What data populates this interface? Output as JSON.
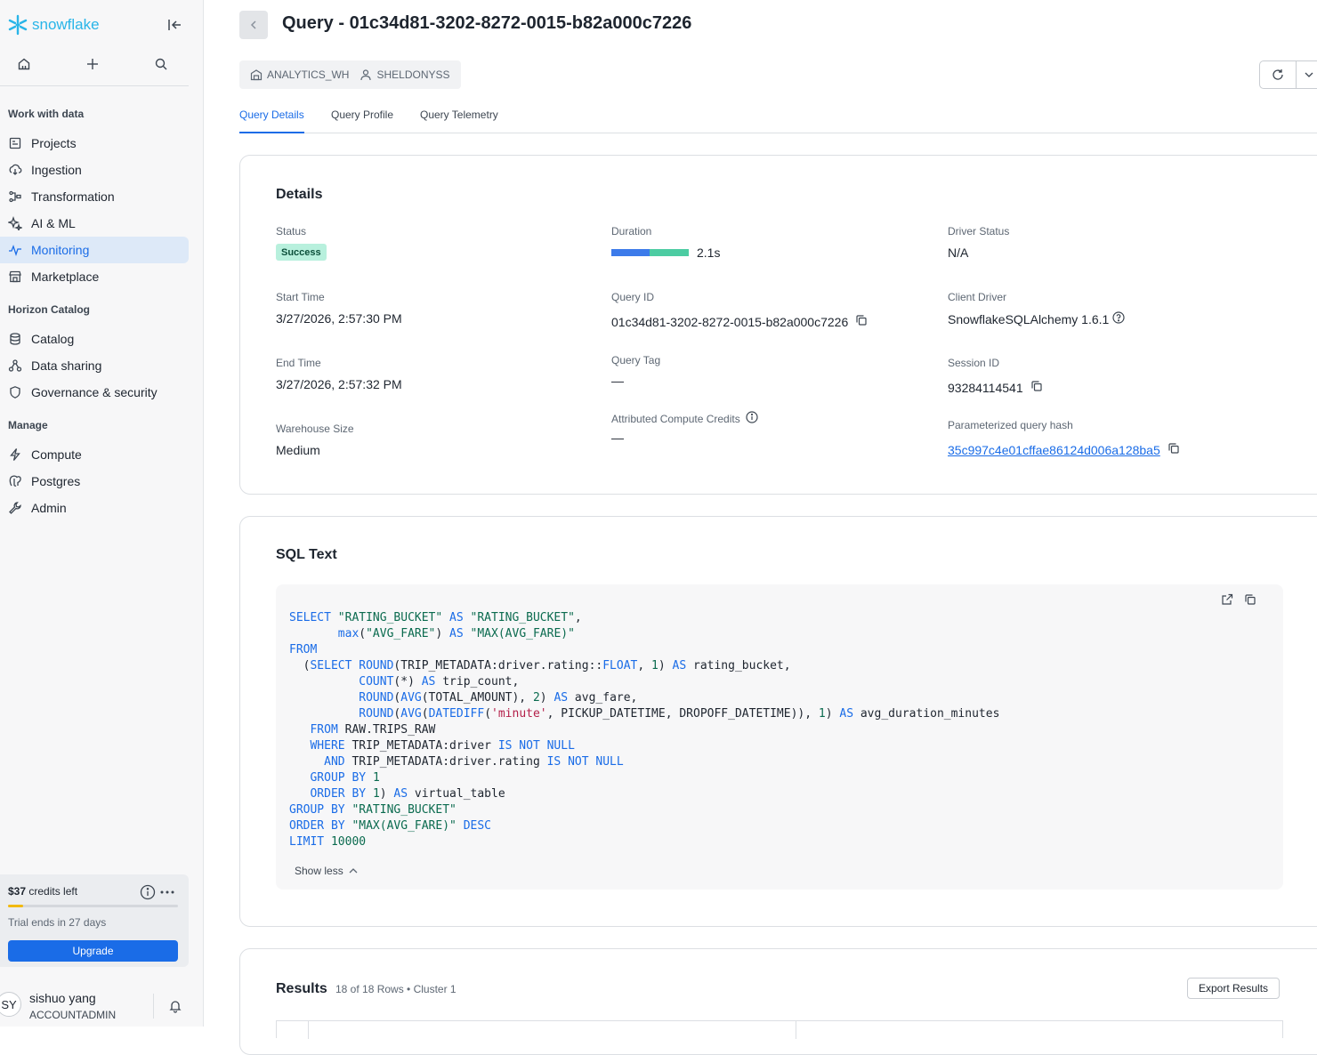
{
  "app": {
    "logo_text": "snowflake",
    "brand_color": "#29b5e8",
    "accent": "#1a6ce7"
  },
  "sidebar": {
    "sections": [
      {
        "title": "Work with data",
        "items": [
          {
            "label": "Projects",
            "icon": "projects-icon"
          },
          {
            "label": "Ingestion",
            "icon": "ingestion-icon"
          },
          {
            "label": "Transformation",
            "icon": "transformation-icon"
          },
          {
            "label": "AI & ML",
            "icon": "ai-ml-icon"
          },
          {
            "label": "Monitoring",
            "icon": "monitoring-icon",
            "active": true
          },
          {
            "label": "Marketplace",
            "icon": "marketplace-icon"
          }
        ]
      },
      {
        "title": "Horizon Catalog",
        "items": [
          {
            "label": "Catalog",
            "icon": "catalog-icon"
          },
          {
            "label": "Data sharing",
            "icon": "data-sharing-icon"
          },
          {
            "label": "Governance & security",
            "icon": "shield-icon"
          }
        ]
      },
      {
        "title": "Manage",
        "items": [
          {
            "label": "Compute",
            "icon": "bolt-icon"
          },
          {
            "label": "Postgres",
            "icon": "postgres-icon"
          },
          {
            "label": "Admin",
            "icon": "admin-icon"
          }
        ]
      }
    ],
    "credits": {
      "amount": "$37",
      "suffix": " credits left",
      "trial": "Trial ends in 27 days",
      "upgrade": "Upgrade",
      "progress": 0.09
    },
    "user": {
      "initials": "SY",
      "name": "sishuo yang",
      "role": "ACCOUNTADMIN"
    }
  },
  "header": {
    "title": "Query - 01c34d81-3202-8272-0015-b82a000c7226",
    "warehouse": "ANALYTICS_WH",
    "owner": "SHELDONYSS"
  },
  "tabs": [
    {
      "label": "Query Details",
      "active": true
    },
    {
      "label": "Query Profile"
    },
    {
      "label": "Query Telemetry"
    }
  ],
  "details": {
    "title": "Details",
    "status_label": "Status",
    "status": "Success",
    "duration_label": "Duration",
    "duration": "2.1s",
    "driver_status_label": "Driver Status",
    "driver_status": "N/A",
    "start_label": "Start Time",
    "start": "3/27/2026, 2:57:30 PM",
    "query_id_label": "Query ID",
    "query_id": "01c34d81-3202-8272-0015-b82a000c7226",
    "client_driver_label": "Client Driver",
    "client_driver": "SnowflakeSQLAlchemy 1.6.1",
    "end_label": "End Time",
    "end": "3/27/2026, 2:57:32 PM",
    "query_tag_label": "Query Tag",
    "query_tag": "—",
    "session_label": "Session ID",
    "session": "93284114541",
    "warehouse_size_label": "Warehouse Size",
    "warehouse_size": "Medium",
    "credits_label": "Attributed Compute Credits",
    "credits": "—",
    "hash_label": "Parameterized query hash",
    "hash": "35c997c4e01cffae86124d006a128ba5"
  },
  "sql": {
    "title": "SQL Text",
    "show_less": "Show less",
    "text": "SELECT \"RATING_BUCKET\" AS \"RATING_BUCKET\",\n       max(\"AVG_FARE\") AS \"MAX(AVG_FARE)\"\nFROM\n  (SELECT ROUND(TRIP_METADATA:driver.rating::FLOAT, 1) AS rating_bucket,\n          COUNT(*) AS trip_count,\n          ROUND(AVG(TOTAL_AMOUNT), 2) AS avg_fare,\n          ROUND(AVG(DATEDIFF('minute', PICKUP_DATETIME, DROPOFF_DATETIME)), 1) AS avg_duration_minutes\n   FROM RAW.TRIPS_RAW\n   WHERE TRIP_METADATA:driver IS NOT NULL\n     AND TRIP_METADATA:driver.rating IS NOT NULL\n   GROUP BY 1\n   ORDER BY 1) AS virtual_table\nGROUP BY \"RATING_BUCKET\"\nORDER BY \"MAX(AVG_FARE)\" DESC\nLIMIT 10000"
  },
  "results": {
    "title": "Results",
    "summary": "18 of 18 Rows • Cluster 1",
    "export": "Export Results"
  }
}
